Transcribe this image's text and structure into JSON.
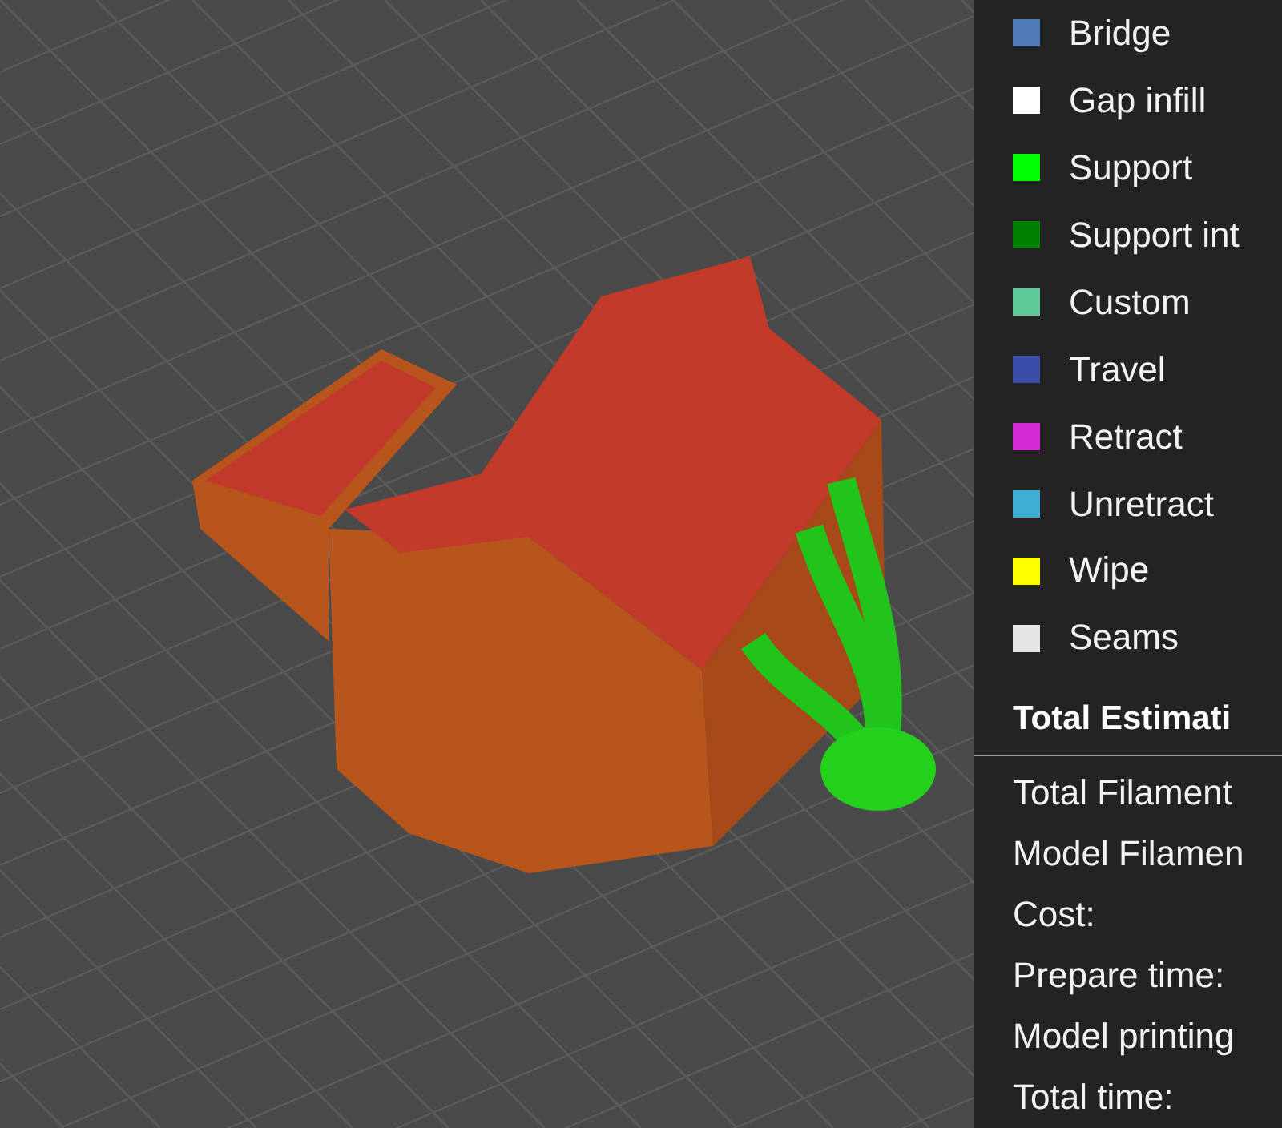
{
  "legend": {
    "items": [
      {
        "label": "Bridge",
        "color": "#4d7ab8"
      },
      {
        "label": "Gap infill",
        "color": "#ffffff"
      },
      {
        "label": "Support",
        "color": "#00ff00"
      },
      {
        "label": "Support int",
        "color": "#008000"
      },
      {
        "label": "Custom",
        "color": "#5ecb97"
      },
      {
        "label": "Travel",
        "color": "#3b4ba8"
      },
      {
        "label": "Retract",
        "color": "#d22bd6"
      },
      {
        "label": "Unretract",
        "color": "#3faed4"
      },
      {
        "label": "Wipe",
        "color": "#ffff00"
      },
      {
        "label": "Seams",
        "color": "#e6e6e6"
      }
    ]
  },
  "estimation": {
    "title": "Total Estimati",
    "rows": [
      "Total Filament",
      "Model Filamen",
      "Cost:",
      "Prepare time:",
      "Model printing",
      "Total time:"
    ]
  }
}
